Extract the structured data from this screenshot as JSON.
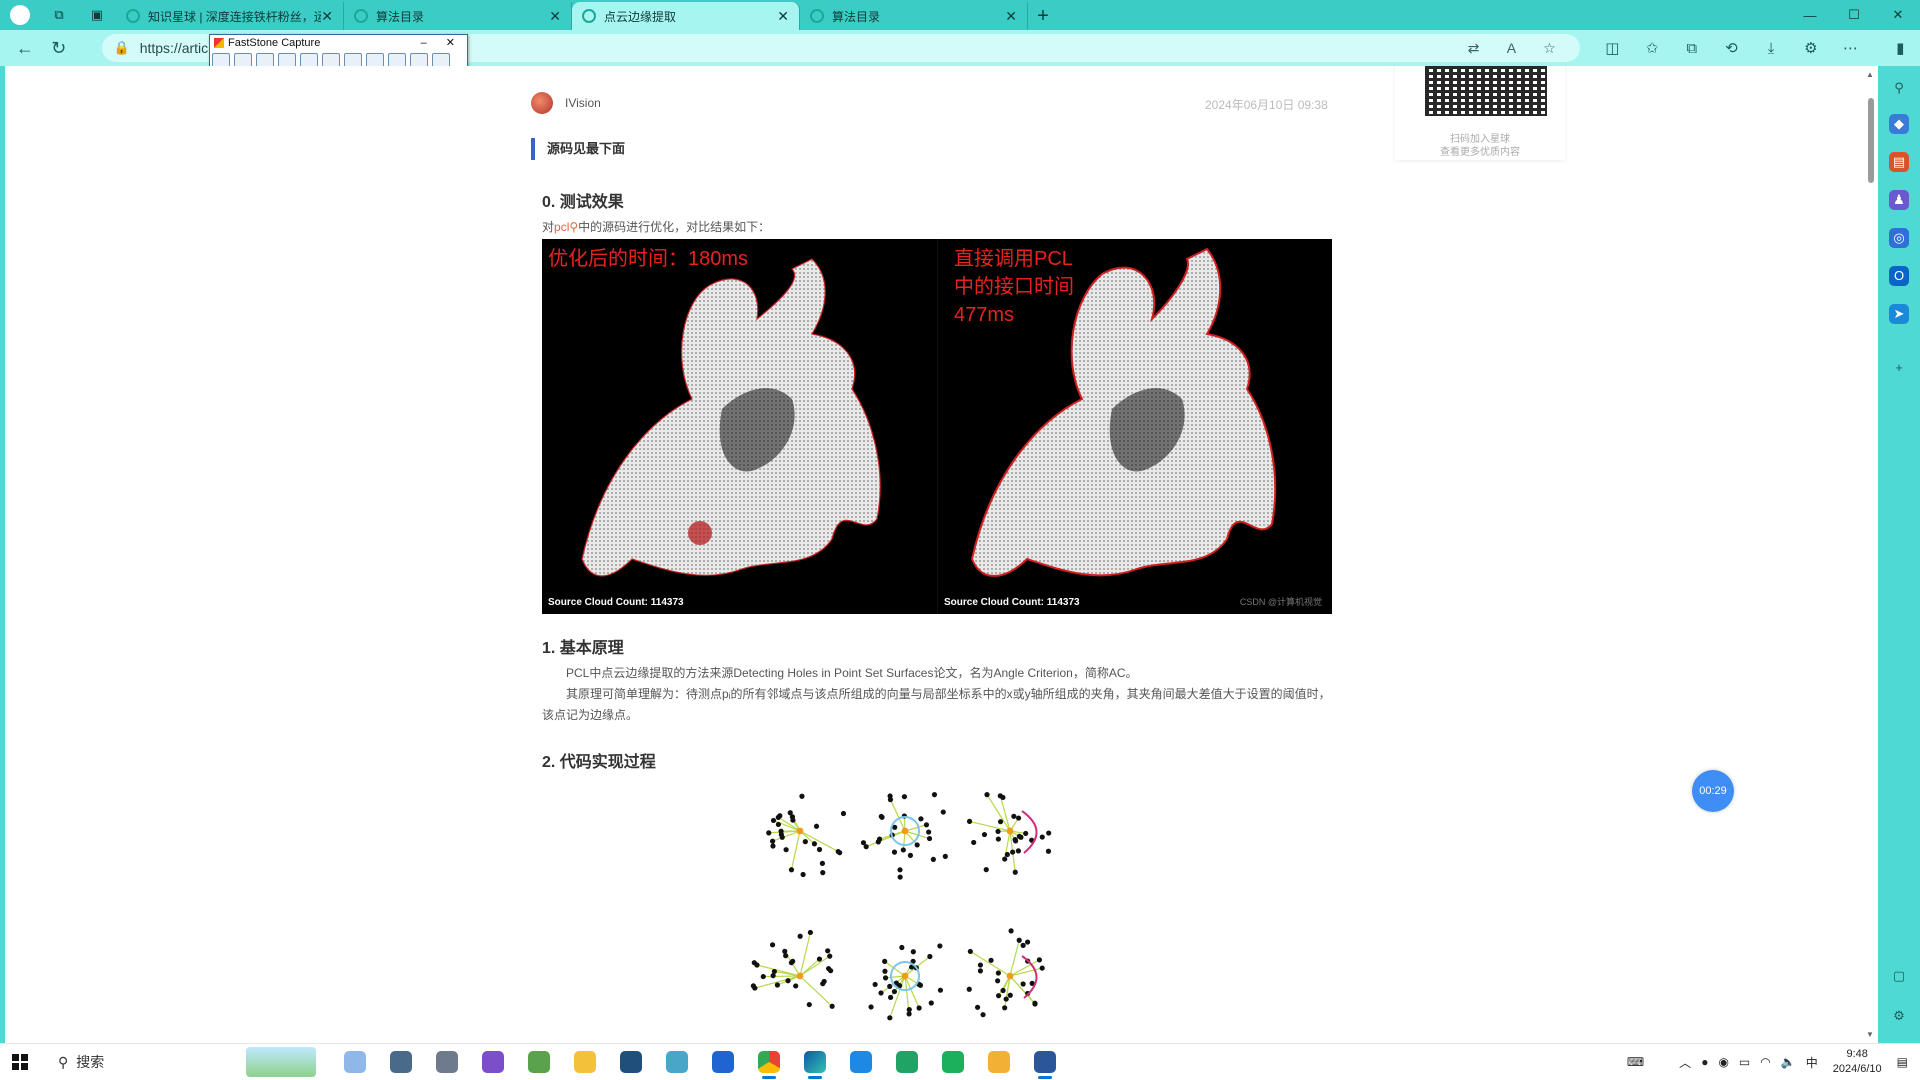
{
  "browser": {
    "tabs": [
      {
        "label": "知识星球 | 深度连接铁杆粉丝，运",
        "active": false
      },
      {
        "label": "算法目录",
        "active": false
      },
      {
        "label": "点云边缘提取",
        "active": true
      },
      {
        "label": "算法目录",
        "active": false
      }
    ],
    "new_tab": "+",
    "url": "https://artic",
    "window_controls": {
      "minimize": "—",
      "maximize": "☐",
      "close": "✕"
    }
  },
  "capture_tool": {
    "title": "FastStone Capture",
    "controls": "– ✕"
  },
  "article": {
    "author": "IVision",
    "date": "2024年06月10日 09:38",
    "note": "源码见最下面",
    "section0_title": "0. 测试效果",
    "section0_intro_prefix": "对",
    "section0_keyword": "pcl",
    "section0_intro_suffix": "中的源码进行优化，对比结果如下：",
    "image": {
      "left_label": "优化后的时间：180ms",
      "right_label_lines": [
        "直接调用PCL",
        "中的接口时间",
        "477ms"
      ],
      "left_caption": "Source Cloud Count: 114373",
      "right_caption": "Source Cloud Count: 114373",
      "watermark": "CSDN @计算机视觉"
    },
    "section1_title": "1. 基本原理",
    "section1_p1": "PCL中点云边缘提取的方法来源Detecting Holes in Point Set Surfaces论文，名为Angle Criterion，简称AC。",
    "section1_p2": "其原理可简单理解为：待测点pᵢ的所有邻域点与该点所组成的向量与局部坐标系中的x或y轴所组成的夹角，其夹角间最大差值大于设置的阈值时，该点记为边缘点。",
    "section2_title": "2. 代码实现过程"
  },
  "sidebar_card": {
    "line1": "扫码加入星球",
    "line2": "查看更多优质内容"
  },
  "timer": "00:29",
  "taskbar": {
    "search_label": "搜索",
    "ime": "中",
    "time": "9:48",
    "date": "2024/6/10"
  }
}
